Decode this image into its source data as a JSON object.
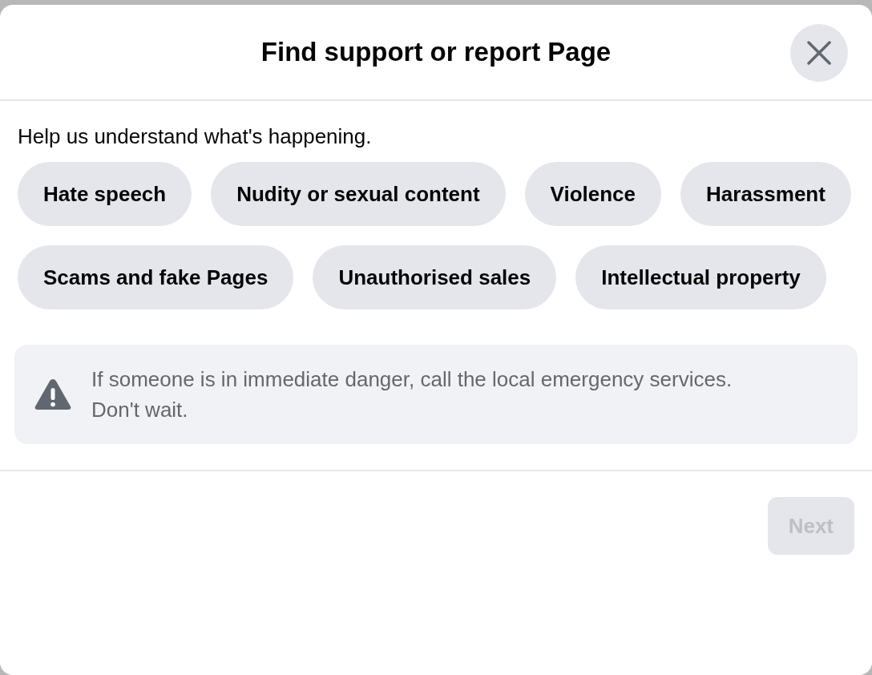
{
  "dialog": {
    "title": "Find support or report Page"
  },
  "prompt": "Help us understand what's happening.",
  "options": [
    {
      "label": "Hate speech",
      "selected": false
    },
    {
      "label": "Nudity or sexual content",
      "selected": false
    },
    {
      "label": "Violence",
      "selected": false
    },
    {
      "label": "Harassment",
      "selected": false
    },
    {
      "label": "Scams and fake Pages",
      "selected": false
    },
    {
      "label": "Unauthorised sales",
      "selected": false
    },
    {
      "label": "Intellectual property",
      "selected": false
    }
  ],
  "notice": "If someone is in immediate danger, call the local emergency services. Don't wait.",
  "next_button": {
    "label": "Next",
    "disabled": true
  }
}
